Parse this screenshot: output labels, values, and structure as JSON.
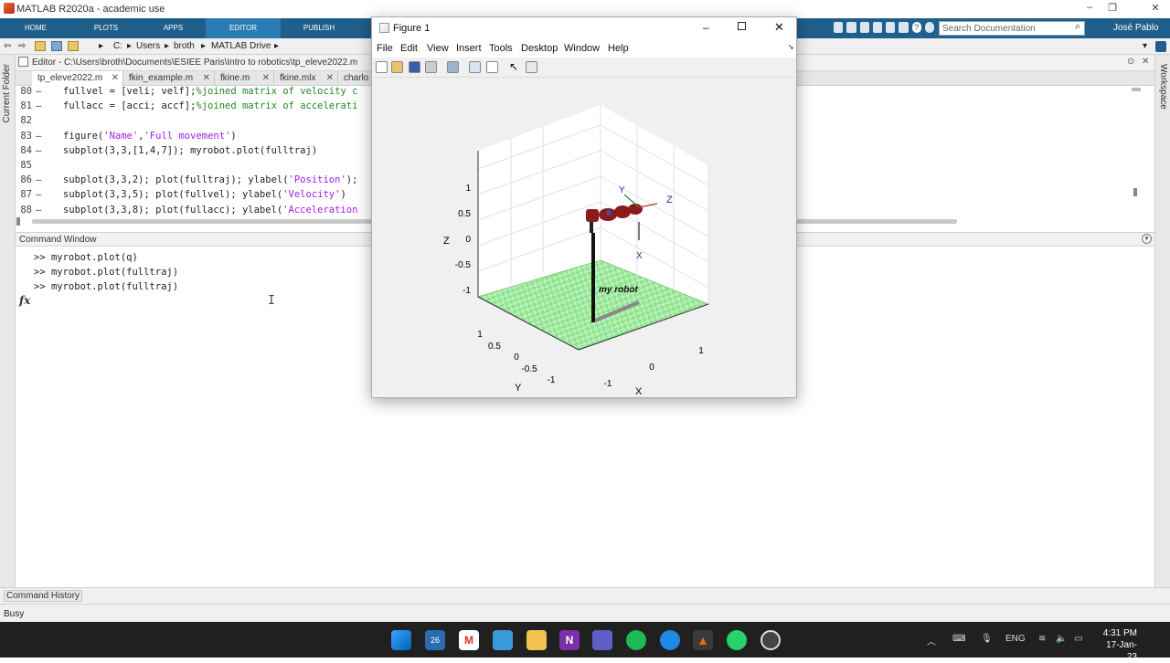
{
  "window": {
    "title": "MATLAB R2020a - academic use"
  },
  "ribbon": {
    "tabs": [
      "HOME",
      "PLOTS",
      "APPS",
      "EDITOR",
      "PUBLISH"
    ],
    "active_tab": "EDITOR",
    "search_placeholder": "Search Documentation",
    "user": "José Pablo"
  },
  "address": {
    "path": [
      "C:",
      "Users",
      "broth",
      "MATLAB Drive"
    ]
  },
  "sidebars": {
    "left": "Current Folder",
    "right": "Workspace"
  },
  "editor": {
    "header": "Editor - C:\\Users\\broth\\Documents\\ESIEE Paris\\Intro to robotics\\tp_eleve2022.m",
    "tabs": [
      "tp_eleve2022.m",
      "fkin_example.m",
      "fkine.m",
      "fkine.mlx",
      "charlo"
    ],
    "active_tab": 0,
    "lines": [
      {
        "n": "80",
        "dash": "–",
        "code": "fullvel = [veli; velf];",
        "comment": "%joined matrix of velocity c"
      },
      {
        "n": "81",
        "dash": "–",
        "code": "fullacc = [acci; accf];",
        "comment": "%joined matrix of accelerati"
      },
      {
        "n": "82",
        "dash": "",
        "code": "",
        "comment": ""
      },
      {
        "n": "83",
        "dash": "–",
        "code": "figure('Name','Full movement')",
        "comment": ""
      },
      {
        "n": "84",
        "dash": "–",
        "code": "subplot(3,3,[1,4,7]); myrobot.plot(fulltraj)",
        "comment": ""
      },
      {
        "n": "85",
        "dash": "",
        "code": "",
        "comment": ""
      },
      {
        "n": "86",
        "dash": "–",
        "code": "subplot(3,3,2); plot(fulltraj); ylabel('Position');",
        "comment": ""
      },
      {
        "n": "87",
        "dash": "–",
        "code": "subplot(3,3,5); plot(fullvel); ylabel('Velocity')",
        "comment": ""
      },
      {
        "n": "88",
        "dash": "–",
        "code": "subplot(3,3,8); plot(fullacc); ylabel('Acceleration",
        "comment": ""
      }
    ]
  },
  "command_window": {
    "title": "Command Window",
    "lines": [
      ">> myrobot.plot(q)",
      ">> myrobot.plot(fulltraj)",
      ">> myrobot.plot(fulltraj)"
    ],
    "prompt_symbol": "fx"
  },
  "command_history": "Command History",
  "status": "Busy",
  "figure": {
    "title": "Figure 1",
    "menu": [
      "File",
      "Edit",
      "View",
      "Insert",
      "Tools",
      "Desktop",
      "Window",
      "Help"
    ],
    "robot_label": "my robot",
    "z_ticks": [
      "1",
      "0.5",
      "0",
      "-0.5",
      "-1"
    ],
    "y_ticks": [
      "1",
      "0.5",
      "0",
      "-0.5",
      "-1"
    ],
    "x_ticks": [
      "1",
      "0",
      "-1"
    ],
    "axis_labels": {
      "x": "X",
      "y": "Y",
      "z": "Z"
    },
    "frame_labels": {
      "x": "X",
      "y": "Y",
      "z": "Z"
    }
  },
  "taskbar": {
    "lang": "ENG",
    "time": "4:31 PM",
    "date": "17-Jan-23",
    "calendar_day": "26"
  }
}
